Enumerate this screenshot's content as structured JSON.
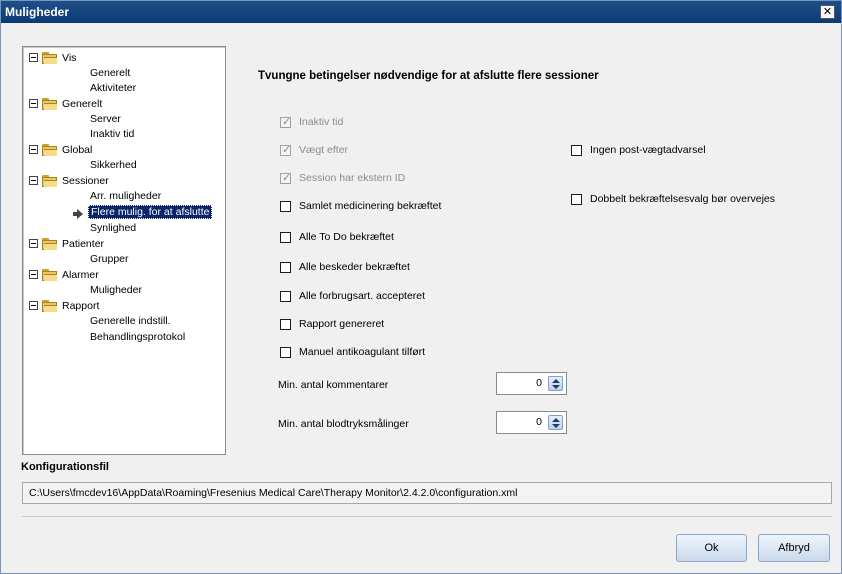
{
  "window": {
    "title": "Muligheder"
  },
  "tree": [
    {
      "label": "Vis",
      "children": [
        "Generelt",
        "Aktiviteter"
      ]
    },
    {
      "label": "Generelt",
      "children": [
        "Server",
        "Inaktiv tid"
      ]
    },
    {
      "label": "Global",
      "children": [
        "Sikkerhed"
      ]
    },
    {
      "label": "Sessioner",
      "children": [
        "Arr. muligheder",
        "Flere mulig. for at afslutte",
        "Synlighed"
      ]
    },
    {
      "label": "Patienter",
      "children": [
        "Grupper"
      ]
    },
    {
      "label": "Alarmer",
      "children": [
        "Muligheder"
      ]
    },
    {
      "label": "Rapport",
      "children": [
        "Generelle indstill.",
        "Behandlingsprotokol"
      ]
    }
  ],
  "selected_item": "Flere mulig. for at afslutte",
  "heading": "Tvungne betingelser nødvendige for at afslutte flere sessioner",
  "left_checkboxes": [
    {
      "label": "Inaktiv tid",
      "checked": true,
      "disabled": true
    },
    {
      "label": "Vægt efter",
      "checked": true,
      "disabled": true
    },
    {
      "label": "Session har ekstern ID",
      "checked": true,
      "disabled": true
    },
    {
      "label": "Samlet medicinering bekræftet",
      "checked": false,
      "disabled": false
    },
    {
      "label": "Alle To Do bekræftet",
      "checked": false,
      "disabled": false
    },
    {
      "label": "Alle beskeder bekræftet",
      "checked": false,
      "disabled": false
    },
    {
      "label": "Alle forbrugsart. accepteret",
      "checked": false,
      "disabled": false
    },
    {
      "label": "Rapport genereret",
      "checked": false,
      "disabled": false
    },
    {
      "label": "Manuel antikoagulant tilført",
      "checked": false,
      "disabled": false
    }
  ],
  "right_checkboxes": [
    {
      "label": "Ingen post-vægtadvarsel",
      "checked": false
    },
    {
      "label": "Dobbelt bekræftelsesvalg bør overvejes",
      "checked": false
    }
  ],
  "min_comments": {
    "label": "Min. antal kommentarer",
    "value": "0"
  },
  "min_bp": {
    "label": "Min. antal blodtryksmålinger",
    "value": "0"
  },
  "config": {
    "title": "Konfigurationsfil",
    "path": "C:\\Users\\fmcdev16\\AppData\\Roaming\\Fresenius Medical Care\\Therapy Monitor\\2.4.2.0\\configuration.xml"
  },
  "buttons": {
    "ok": "Ok",
    "cancel": "Afbryd"
  },
  "icons": {
    "close": "close-icon",
    "folder": "folder-icon",
    "expander": "collapse-icon",
    "arrow": "arrow-right-icon"
  }
}
